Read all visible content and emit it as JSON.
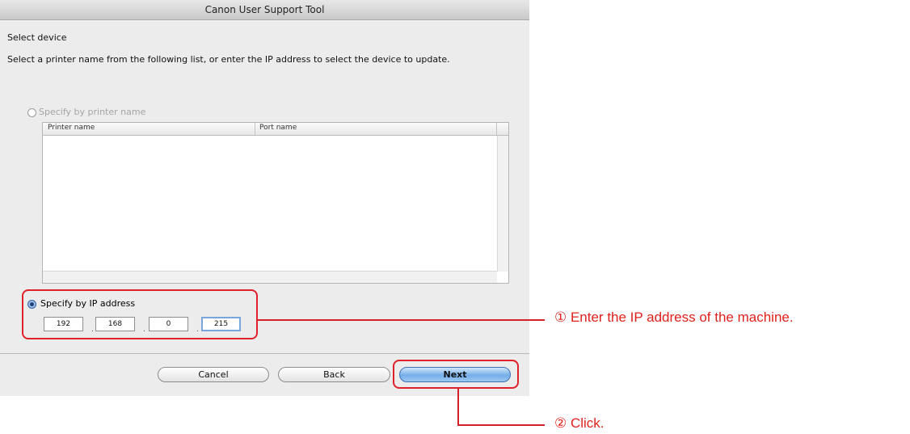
{
  "window": {
    "title": "Canon User Support Tool"
  },
  "dialog": {
    "section_title": "Select device",
    "instruction": "Select a printer name from the following list, or enter the IP address to select the device to update.",
    "option_printer_name": "Specify by printer name",
    "option_ip_address": "Specify by IP address",
    "selected_option": "ip_address",
    "table": {
      "columns": [
        "Printer name",
        "Port name"
      ],
      "rows": []
    },
    "ip_address": {
      "octet1": "192",
      "octet2": "168",
      "octet3": "0",
      "octet4": "215",
      "separator": "."
    },
    "buttons": {
      "cancel": "Cancel",
      "back": "Back",
      "next": "Next"
    }
  },
  "annotations": {
    "step1": "① Enter the IP address of the machine.",
    "step2": "② Click.",
    "highlight_color": "#e0212b"
  }
}
